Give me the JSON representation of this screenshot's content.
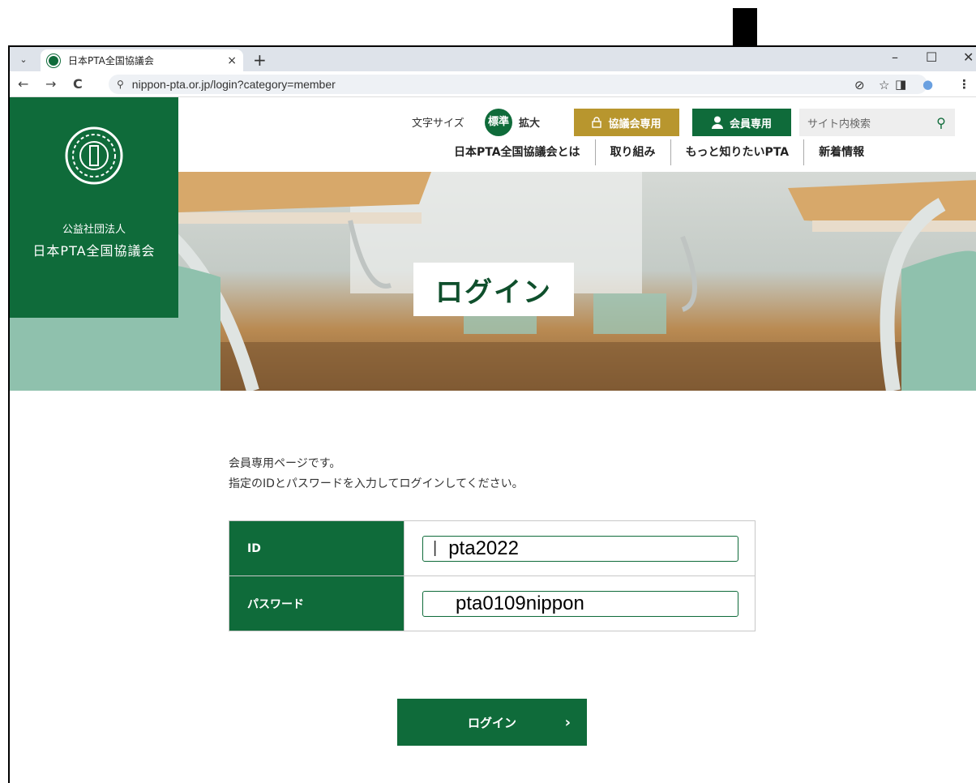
{
  "browser": {
    "tab_title": "日本PTA全国協議会",
    "tab_close": "×",
    "new_tab": "+",
    "tab_list": "⌄",
    "window_controls": {
      "minimize": "–",
      "maximize": "☐",
      "close": "✕"
    },
    "nav": {
      "back": "←",
      "forward": "→",
      "reload": "C"
    },
    "site_info": "⚲",
    "url": "nippon-pta.or.jp/login?category=member",
    "toolbar_icons": {
      "eye_off": "⊘",
      "star": "☆",
      "side_panel": "◨",
      "profile": "●",
      "menu": "⋮"
    }
  },
  "site": {
    "org_type": "公益社団法人",
    "org_name": "日本PTA全国協議会",
    "fontsize_label": "文字サイズ",
    "size_standard": "標準",
    "size_large": "拡大",
    "council_only": "協議会専用",
    "member_only": "会員専用",
    "search_placeholder": "サイト内検索",
    "search_icon": "⚲",
    "nav": [
      {
        "label": "日本PTA全国協議会とは"
      },
      {
        "label": "取り組み"
      },
      {
        "label": "もっと知りたいPTA"
      },
      {
        "label": "新着情報"
      }
    ],
    "hero_title": "ログイン"
  },
  "login": {
    "intro_line1": "会員専用ページです。",
    "intro_line2": "指定のIDとパスワードを入力してログインしてください。",
    "id_label": "ID",
    "id_value": "pta2022",
    "id_caret": "|",
    "password_label": "パスワード",
    "password_value": "pta0109nippon",
    "submit_label": "ログイン",
    "submit_arrow": "›"
  },
  "colors": {
    "brand_green": "#0f6b3a",
    "council_gold": "#b8962e"
  }
}
